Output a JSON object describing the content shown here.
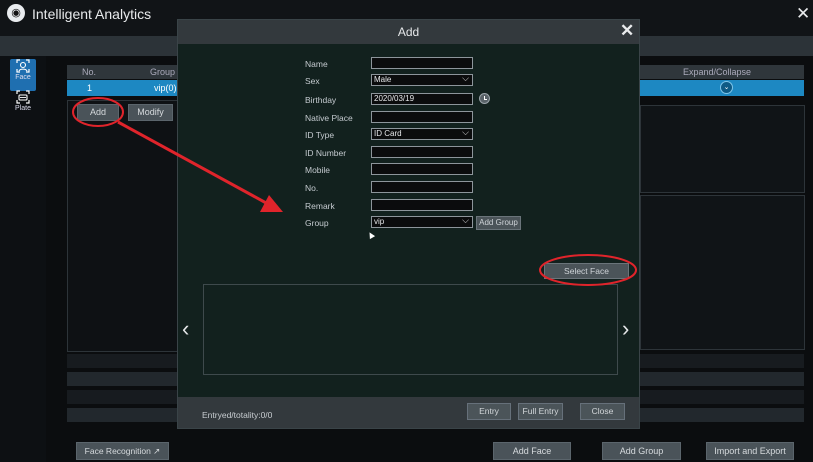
{
  "app": {
    "title": "Intelligent Analytics",
    "logo_icon": "camera-logo-icon",
    "close_symbol": "✕"
  },
  "sidebar": {
    "items": [
      {
        "label": "Face",
        "icon": "face-icon",
        "active": true
      },
      {
        "label": "Plate",
        "icon": "plate-icon",
        "active": false
      }
    ]
  },
  "group_table": {
    "columns": {
      "no": "No.",
      "group": "Group",
      "expand": "Expand/Collapse"
    },
    "rows": [
      {
        "no": "1",
        "group": "vip(0)"
      }
    ],
    "expand_symbol": "⌄"
  },
  "actions": {
    "add": "Add",
    "modify": "Modify"
  },
  "footer_buttons": {
    "face_recognition": "Face Recognition ↗",
    "add_face": "Add Face",
    "add_group": "Add Group",
    "import_export": "Import and Export"
  },
  "dialog": {
    "title": "Add",
    "close_symbol": "✕",
    "fields": {
      "name": {
        "label": "Name",
        "value": ""
      },
      "sex": {
        "label": "Sex",
        "value": "Male"
      },
      "birthday": {
        "label": "Birthday",
        "value": "2020/03/19"
      },
      "native_place": {
        "label": "Native Place",
        "value": ""
      },
      "id_type": {
        "label": "ID Type",
        "value": "ID Card"
      },
      "id_number": {
        "label": "ID Number",
        "value": ""
      },
      "mobile": {
        "label": "Mobile",
        "value": ""
      },
      "no": {
        "label": "No.",
        "value": ""
      },
      "remark": {
        "label": "Remark",
        "value": ""
      },
      "group": {
        "label": "Group",
        "value": "vip"
      }
    },
    "add_group_button": "Add Group",
    "select_face_button": "Select Face",
    "prev_symbol": "‹",
    "next_symbol": "›",
    "entry_count": "Entryed/totality:0/0",
    "buttons": {
      "entry": "Entry",
      "full_entry": "Full Entry",
      "close": "Close"
    }
  },
  "annotation_color": "#e0242b"
}
